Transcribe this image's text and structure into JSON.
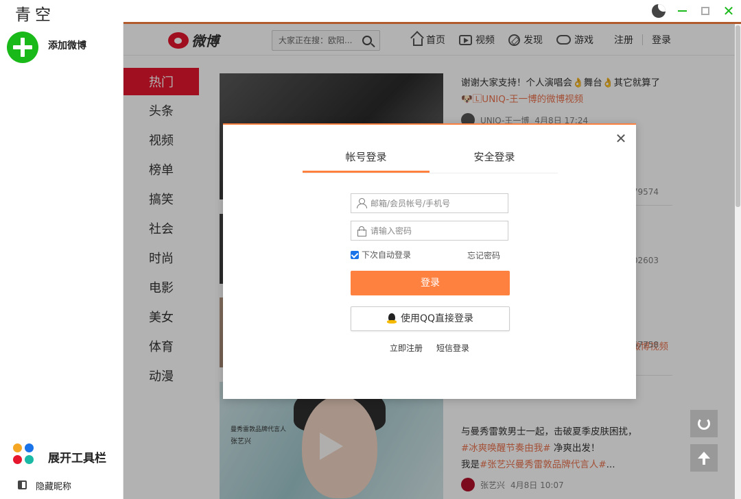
{
  "window": {
    "title": "青空"
  },
  "sidebar": {
    "add_label": "添加微博",
    "toolbar_label": "展开工具栏",
    "hide_nick_label": "隐藏昵称",
    "dot_colors": [
      "#f5a623",
      "#1a73e8",
      "#e6162d",
      "#1ab9a6"
    ]
  },
  "weibo": {
    "logo_text": "微博",
    "search_placeholder": "大家正在搜：欧阳...",
    "nav": [
      {
        "label": "首页",
        "icon": "home-icon"
      },
      {
        "label": "视频",
        "icon": "video-icon"
      },
      {
        "label": "发现",
        "icon": "discover-icon"
      },
      {
        "label": "游戏",
        "icon": "game-icon"
      }
    ],
    "register": "注册",
    "login": "登录",
    "categories": [
      "热门",
      "头条",
      "视频",
      "榜单",
      "搞笑",
      "社会",
      "时尚",
      "电影",
      "美女",
      "体育",
      "动漫"
    ],
    "active_category": "热门",
    "accent_color": "#ff8140"
  },
  "feed": {
    "post1": {
      "text": "谢谢大家支持！个人演唱会👌舞台👌其它就算了",
      "link_prefix": "🐶",
      "link": "🄻UNIQ-王一博的微博视频",
      "author": "UNIQ-王一博",
      "time": "4月8日 17:24",
      "count": "4479574"
    },
    "post2": {
      "count": "2602603"
    },
    "post3": {
      "link_tail": "微博视频",
      "count": "257758"
    },
    "post4": {
      "line1": "与曼秀雷敦男士一起，击破夏季皮肤困扰，",
      "line2_link": "#冰爽唤醒节奏由我#",
      "line2_rest": " 净爽出发！",
      "line3_prefix": "我是",
      "line3_link": "#张艺兴曼秀雷敦品牌代言人#",
      "line3_rest": "...",
      "author": "张艺兴",
      "time": "4月8日 10:07",
      "thumb_caption": "曼秀雷敦品牌代言人",
      "thumb_name": "张艺兴"
    }
  },
  "login_modal": {
    "tab_account": "帐号登录",
    "tab_secure": "安全登录",
    "username_placeholder": "邮箱/会员帐号/手机号",
    "password_placeholder": "请输入密码",
    "remember_label": "下次自动登录",
    "remember_checked": true,
    "forgot_label": "忘记密码",
    "login_button": "登录",
    "qq_button": "使用QQ直接登录",
    "register_link": "立即注册",
    "sms_link": "短信登录",
    "close_icon": "close-icon"
  }
}
